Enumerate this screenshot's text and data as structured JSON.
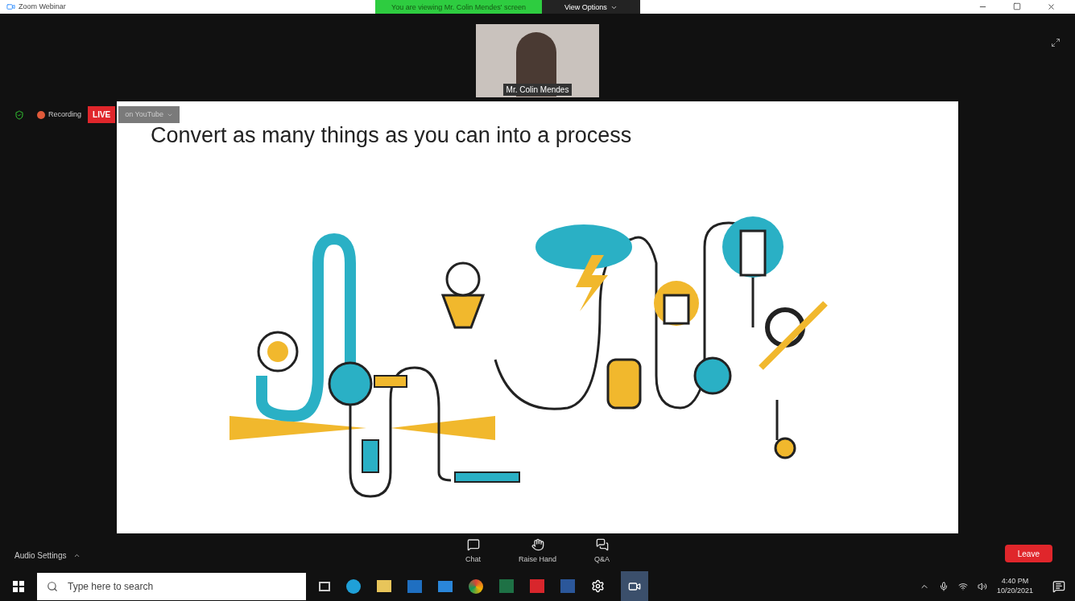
{
  "window": {
    "title": "Zoom Webinar"
  },
  "banner": {
    "text": "You are viewing Mr. Colin Mendes' screen",
    "view_options": "View Options"
  },
  "video": {
    "name": "Mr. Colin Mendes"
  },
  "status": {
    "recording": "Recording",
    "live": "LIVE",
    "stream": "on YouTube"
  },
  "slide": {
    "title": "Convert as many things as you can into a process"
  },
  "controls": {
    "audio": "Audio Settings",
    "buttons": [
      {
        "kind": "chat",
        "label": "Chat"
      },
      {
        "kind": "hand",
        "label": "Raise Hand"
      },
      {
        "kind": "qa",
        "label": "Q&A"
      }
    ],
    "leave": "Leave"
  },
  "taskbar": {
    "search": {
      "placeholder": "Type here to search"
    },
    "time": "4:40 PM",
    "date": "10/20/2021"
  }
}
